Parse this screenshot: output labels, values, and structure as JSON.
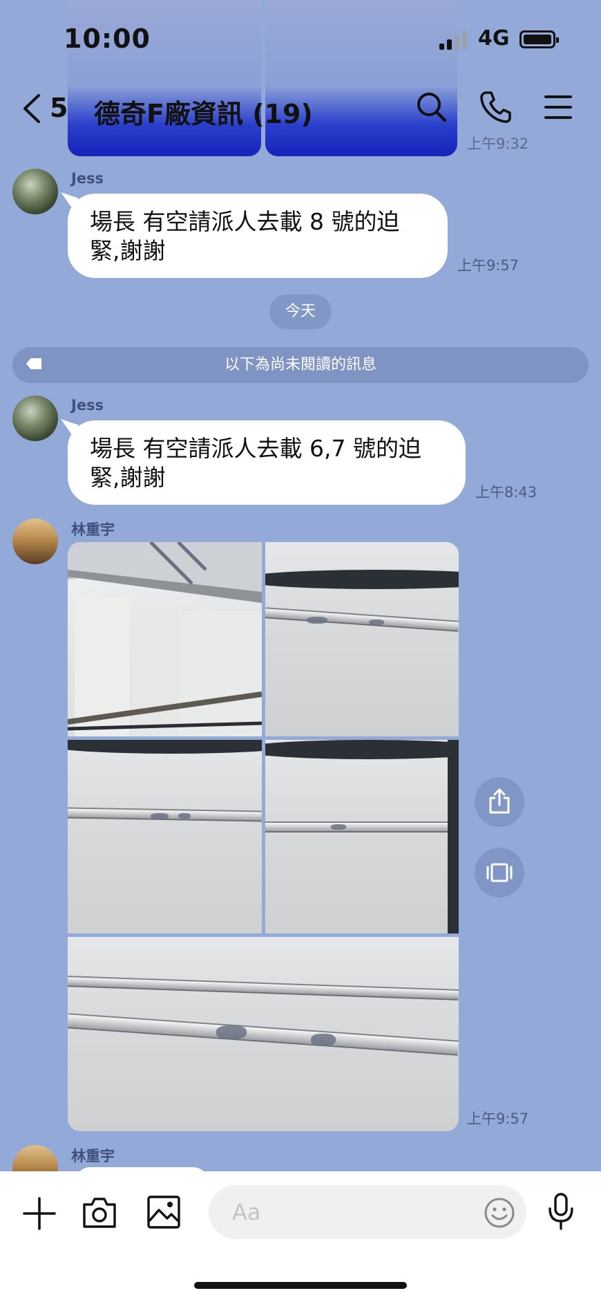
{
  "status": {
    "time": "10:00",
    "network": "4G"
  },
  "header": {
    "back_count": "5",
    "title": "德奇F廠資訊 (19)"
  },
  "top_partial": {
    "timestamp": "上午9:32"
  },
  "messages": [
    {
      "sender": "Jess",
      "line1": "場長  有空請派人去載 8 號的迫",
      "line2": "緊,謝謝",
      "timestamp": "上午9:57"
    },
    {
      "sender": "Jess",
      "line1": "場長  有空請派人去載 6,7 號的迫",
      "line2": "緊,謝謝",
      "timestamp": "上午8:43"
    },
    {
      "sender": "林重宇",
      "type": "photos",
      "count": 5,
      "timestamp": "上午9:57"
    },
    {
      "sender": "林重宇"
    }
  ],
  "day_separator": "今天",
  "unread_banner": "以下為尚未閱讀的訊息",
  "input": {
    "placeholder": "Aa"
  },
  "icons": {
    "back": "chevron-left-icon",
    "search": "search-icon",
    "call": "phone-icon",
    "menu": "menu-icon",
    "share": "share-icon",
    "carousel": "carousel-icon",
    "plus": "plus-icon",
    "camera": "camera-icon",
    "image": "image-icon",
    "emoji": "emoji-icon",
    "mic": "microphone-icon"
  },
  "colors": {
    "chat_background": "#93a9d8",
    "bubble": "#ffffff"
  }
}
